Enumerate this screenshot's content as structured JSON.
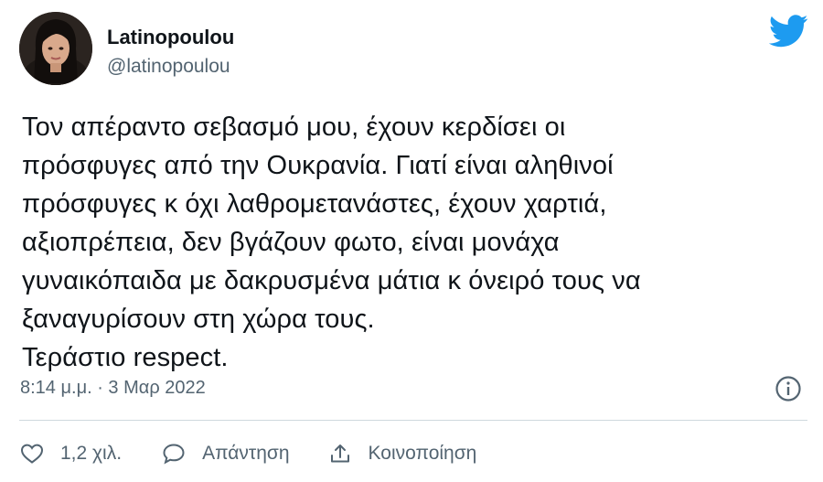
{
  "author": {
    "display_name": "Latinopoulou",
    "handle": "@latinopoulou"
  },
  "tweet": {
    "lines": [
      "Τον απέραντο σεβασμό μου, έχουν κερδίσει οι",
      "πρόσφυγες από την Ουκρανία. Γιατί είναι αληθινοί",
      "πρόσφυγες κ όχι λαθρομετανάστες, έχουν χαρτιά,",
      "αξιοπρέπεια, δεν βγάζουν φωτο, είναι μονάχα",
      "γυναικόπαιδα με δακρυσμένα μάτια κ όνειρό τους να",
      "ξαναγυρίσουν στη χώρα τους.",
      "Τεράστιο respect."
    ],
    "timestamp": "8:14 μ.μ. · 3 Μαρ 2022"
  },
  "actions": {
    "like_count": "1,2 χιλ.",
    "reply_label": "Απάντηση",
    "share_label": "Κοινοποίηση"
  },
  "colors": {
    "twitter_blue": "#1d9bf0",
    "secondary_text": "#536471",
    "primary_text": "#0f1419",
    "divider": "#cfd9de"
  },
  "icons": {
    "brand": "twitter-bird-icon",
    "info": "info-icon",
    "like": "heart-icon",
    "reply": "speech-bubble-icon",
    "share": "share-icon"
  }
}
